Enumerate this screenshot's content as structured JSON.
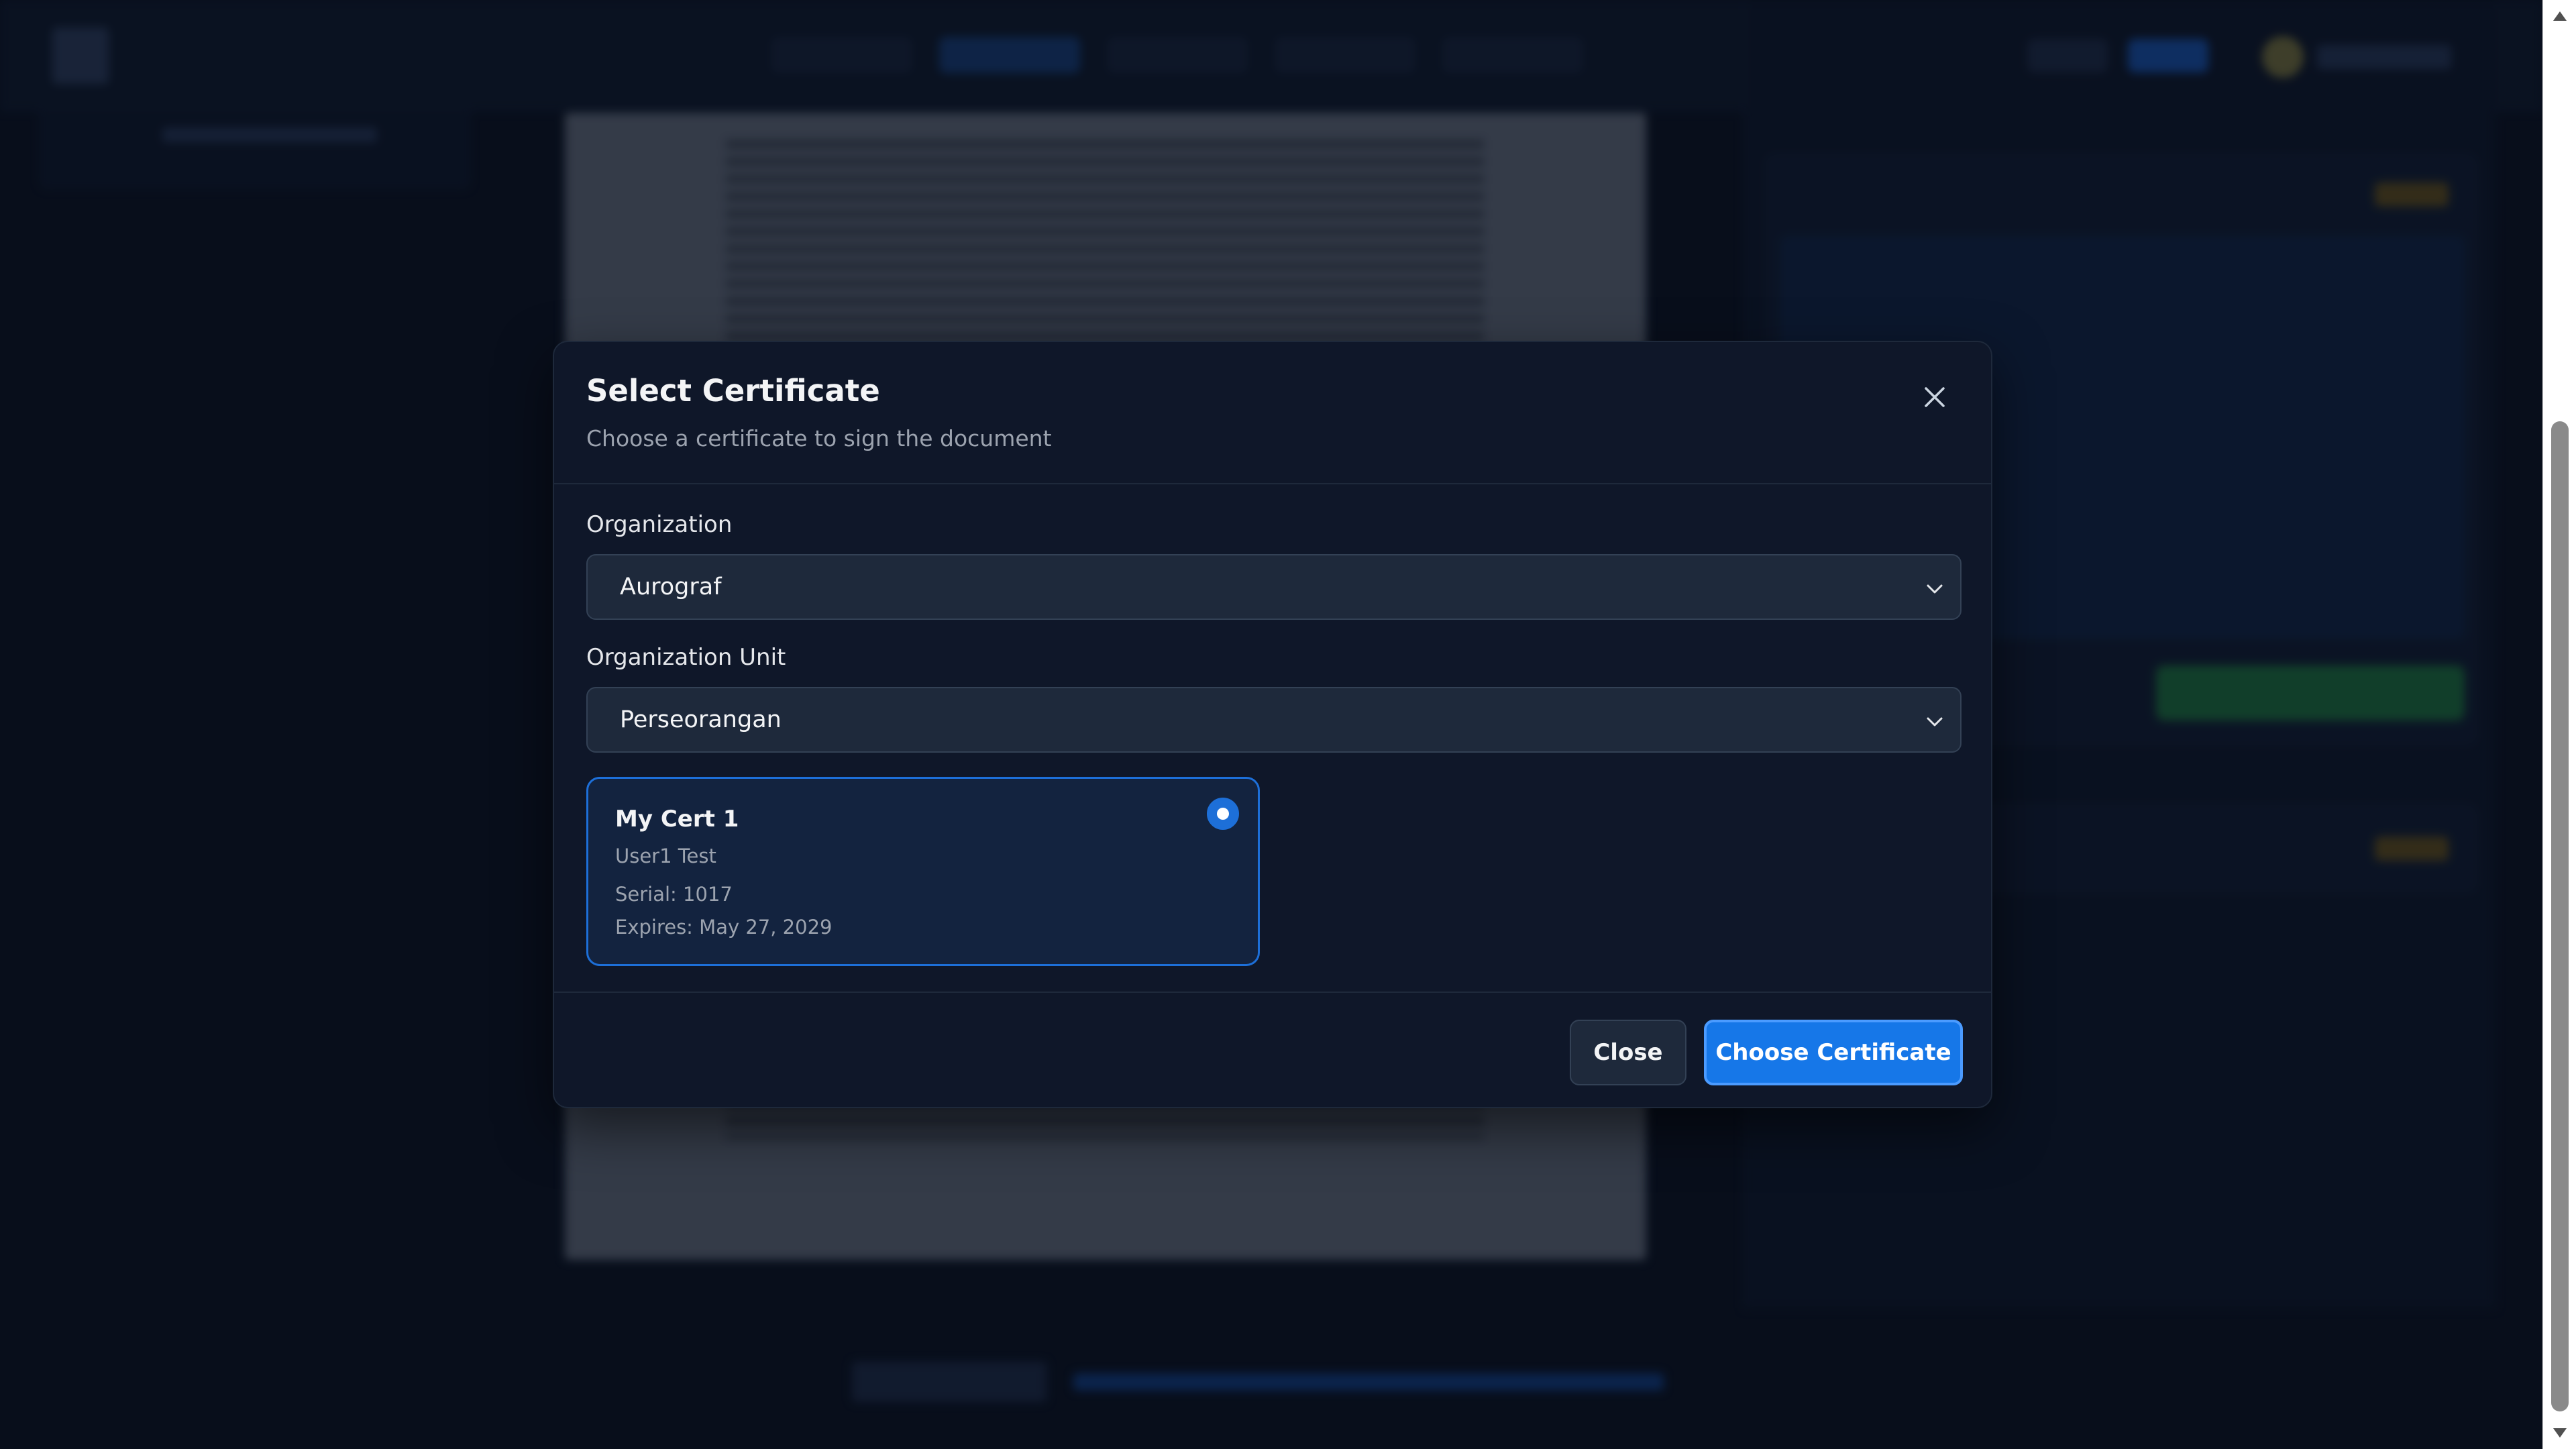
{
  "modal": {
    "title": "Select Certificate",
    "subtitle": "Choose a certificate to sign the document",
    "organization": {
      "label": "Organization",
      "selected": "Aurograf"
    },
    "organization_unit": {
      "label": "Organization Unit",
      "selected": "Perseorangan"
    },
    "certificates": [
      {
        "name": "My Cert 1",
        "owner": "User1 Test",
        "serial": "Serial: 1017",
        "expires": "Expires: May 27, 2029",
        "selected": true
      }
    ],
    "buttons": {
      "close": "Close",
      "choose": "Choose Certificate"
    }
  },
  "colors": {
    "page_background": "#0b1322",
    "modal_background": "#0f1729",
    "accent": "#1677e8",
    "selected_card": "#13233f"
  },
  "icons": {
    "close": "close-icon",
    "dropdown": "chevron-down-icon",
    "radio": "radio-selected-icon",
    "scroll_up": "triangle-up-icon",
    "scroll_down": "triangle-down-icon"
  }
}
